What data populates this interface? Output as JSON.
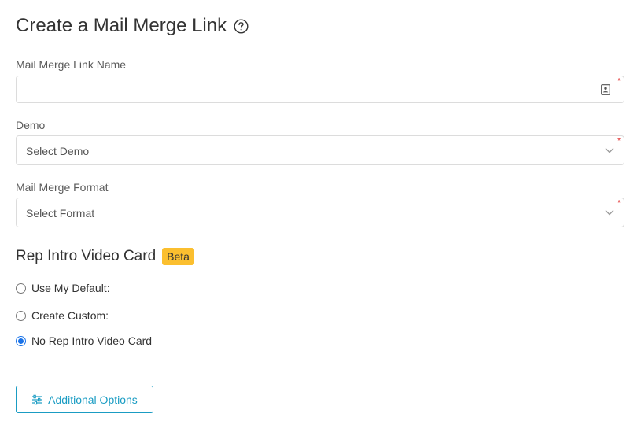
{
  "header": {
    "title": "Create a Mail Merge Link",
    "help_icon": "question-circle-icon"
  },
  "form": {
    "link_name": {
      "label": "Mail Merge Link Name",
      "value": "",
      "placeholder": "",
      "required": true,
      "icon": "contact-card-icon"
    },
    "demo": {
      "label": "Demo",
      "selected": "Select Demo",
      "required": true
    },
    "format": {
      "label": "Mail Merge Format",
      "selected": "Select Format",
      "required": true
    }
  },
  "rep_intro": {
    "title": "Rep Intro Video Card",
    "badge": "Beta",
    "options": [
      {
        "label": "Use My Default:",
        "checked": false
      },
      {
        "label": "Create Custom:",
        "checked": false
      },
      {
        "label": "No Rep Intro Video Card",
        "checked": true
      }
    ]
  },
  "additional_options": {
    "label": "Additional Options",
    "icon": "sliders-icon"
  },
  "colors": {
    "accent": "#1a9cc3",
    "radio_selected": "#1a73e8",
    "badge_bg": "#fbbf2f",
    "required": "#e02020"
  }
}
